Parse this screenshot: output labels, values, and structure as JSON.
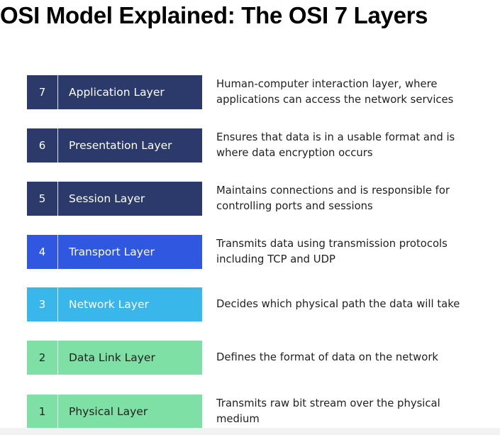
{
  "title": "OSI Model Explained: The OSI 7 Layers",
  "colors": {
    "navy": "#2b3a6b",
    "blue": "#2f57e0",
    "cyan": "#39b6ea",
    "green": "#7fe0a5"
  },
  "layers": [
    {
      "number": "7",
      "name": "Application Layer",
      "description": "Human-computer interaction layer, where applications can access the network services",
      "color": "#2b3a6b"
    },
    {
      "number": "6",
      "name": "Presentation Layer",
      "description": "Ensures that data is in a usable format and is where data encryption occurs",
      "color": "#2b3a6b"
    },
    {
      "number": "5",
      "name": "Session Layer",
      "description": "Maintains connections and is responsible for controlling ports and sessions",
      "color": "#2b3a6b"
    },
    {
      "number": "4",
      "name": "Transport Layer",
      "description": "Transmits data using transmission protocols including TCP and UDP",
      "color": "#2f57e0"
    },
    {
      "number": "3",
      "name": "Network Layer",
      "description": "Decides which physical path the data will take",
      "color": "#39b6ea"
    },
    {
      "number": "2",
      "name": "Data Link Layer",
      "description": "Defines the format of data on the network",
      "color": "#7fe0a5"
    },
    {
      "number": "1",
      "name": "Physical Layer",
      "description": "Transmits raw bit stream over the physical medium",
      "color": "#7fe0a5"
    }
  ]
}
